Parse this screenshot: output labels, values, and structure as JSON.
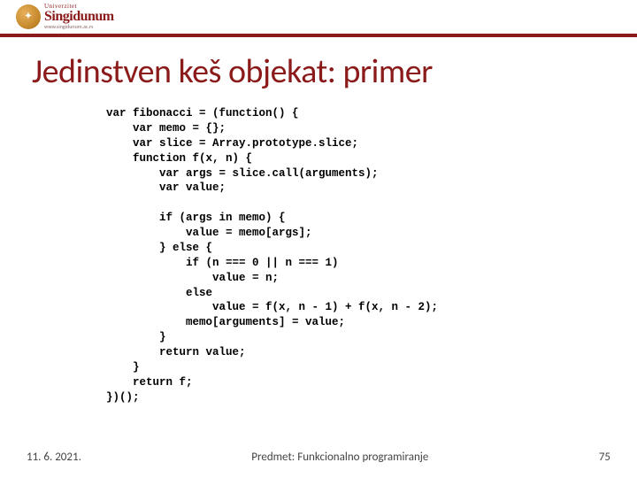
{
  "logo": {
    "top_label": "Univerzitet",
    "name": "Singidunum",
    "url": "www.singidunum.ac.rs"
  },
  "title": "Jedinstven keš objekat: primer",
  "code": "var fibonacci = (function() {\n    var memo = {};\n    var slice = Array.prototype.slice;\n    function f(x, n) {\n        var args = slice.call(arguments);\n        var value;\n\n        if (args in memo) {\n            value = memo[args];\n        } else {\n            if (n === 0 || n === 1)\n                value = n;\n            else\n                value = f(x, n - 1) + f(x, n - 2);\n            memo[arguments] = value;\n        }\n        return value;\n    }\n    return f;\n})();",
  "footer": {
    "date": "11. 6. 2021.",
    "subject": "Predmet: Funkcionalno programiranje",
    "page": "75"
  }
}
